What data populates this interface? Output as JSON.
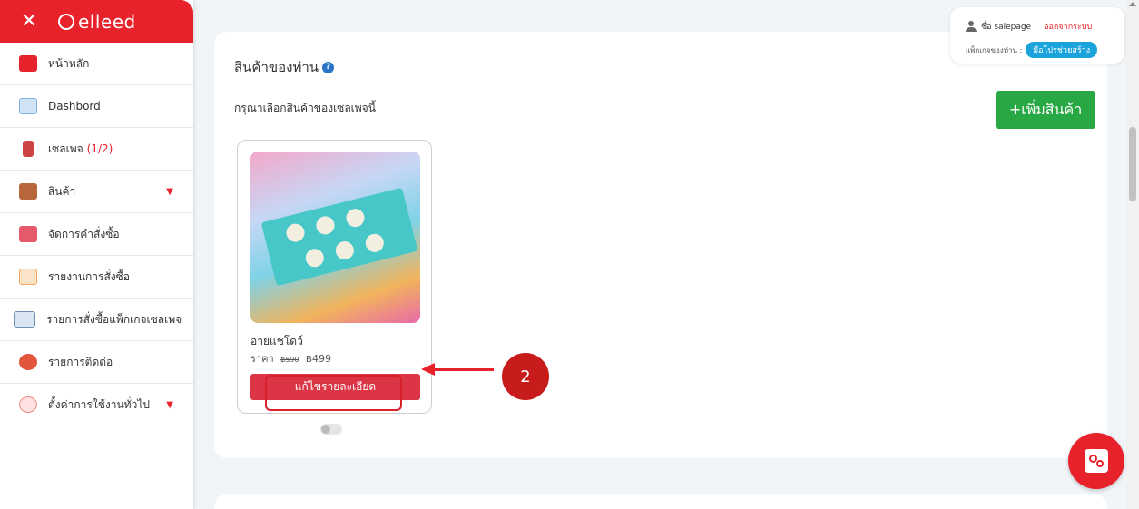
{
  "sidebar": {
    "close_symbol": "✕",
    "logo_text": "elleed",
    "items": [
      {
        "label": "หน้าหลัก",
        "icon": "home-icon",
        "color": "#e8222b"
      },
      {
        "label": "Dashbord",
        "icon": "dashboard-icon",
        "color": "#7fb3e0"
      },
      {
        "label": "เซลเพจ",
        "count": "(1/2)",
        "icon": "salepage-icon",
        "color": "#c44"
      },
      {
        "label": "สินค้า",
        "icon": "product-icon",
        "color": "#b8663c",
        "has_dropdown": true
      },
      {
        "label": "จัดการคำสั่งซื้อ",
        "icon": "order-icon",
        "color": "#e45a6a"
      },
      {
        "label": "รายงานการสั่งซื้อ",
        "icon": "report-icon",
        "color": "#f0a05a"
      },
      {
        "label": "รายการสั่งซื้อแพ็กเกจเซลเพจ",
        "icon": "laptop-icon",
        "color": "#6f8fb5"
      },
      {
        "label": "รายการติดต่อ",
        "icon": "contact-icon",
        "color": "#e4553e"
      },
      {
        "label": "ตั้งค่าการใช้งานทั่วไป",
        "icon": "settings-icon",
        "color": "#f08a8a",
        "has_dropdown": true
      }
    ],
    "caret_symbol": "▼"
  },
  "main": {
    "title": "สินค้าของท่าน",
    "help_symbol": "?",
    "subtitle": "กรุณาเลือกสินค้าของเซลเพจนี้",
    "add_button": "+เพิ่มสินค้า"
  },
  "product": {
    "name": "อายแชโดว์",
    "price_label": "ราคา",
    "original_price": "฿590",
    "price": "฿499",
    "edit_button": "แก้ไขรายละเอียด",
    "enabled": false
  },
  "annotation": {
    "step_number": "2"
  },
  "user_panel": {
    "name_label": "ชื่อ salepage",
    "logout": "ออกจากระบบ",
    "package_label": "แพ็กเกจของท่าน :",
    "package_name": "มือโปรช่วยสร้าง"
  },
  "colors": {
    "brand_red": "#e8222b",
    "add_green": "#27a844",
    "edit_red": "#dc3545",
    "badge_blue": "#1ba4db"
  }
}
